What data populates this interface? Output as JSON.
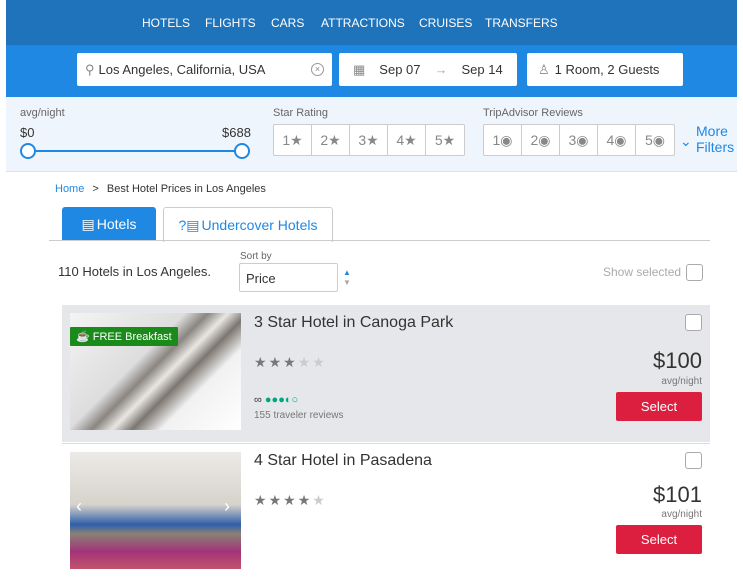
{
  "nav": [
    "HOTELS",
    "FLIGHTS",
    "CARS",
    "ATTRACTIONS",
    "CRUISES",
    "TRANSFERS"
  ],
  "search": {
    "location": "Los Angeles, California, USA",
    "checkin": "Sep 07",
    "checkout": "Sep 14",
    "guests": "1 Room, 2 Guests"
  },
  "filters": {
    "price_label": "avg/night",
    "min": "$0",
    "max": "$688",
    "star_label": "Star Rating",
    "stars": [
      "1",
      "2",
      "3",
      "4",
      "5"
    ],
    "ta_label": "TripAdvisor Reviews",
    "ta": [
      "1",
      "2",
      "3",
      "4",
      "5"
    ],
    "more": "More",
    "more2": "Filters"
  },
  "breadcrumb": {
    "home": "Home",
    "sep": ">",
    "current": "Best Hotel Prices in Los Angeles"
  },
  "tabs": {
    "hotels": "Hotels",
    "undercover": "Undercover Hotels"
  },
  "results": {
    "count": "110 Hotels in Los Angeles.",
    "sort_label": "Sort by",
    "sort_value": "Price",
    "show_selected": "Show selected"
  },
  "hotels": [
    {
      "name": "3 Star Hotel in Canoga Park",
      "stars": 3,
      "badge": "FREE Breakfast",
      "ta_rating": 3.5,
      "reviews": "155 traveler reviews",
      "price": "$100",
      "per": "avg/night",
      "select": "Select"
    },
    {
      "name": "4 Star Hotel in Pasadena",
      "stars": 4,
      "price": "$101",
      "per": "avg/night",
      "select": "Select"
    }
  ],
  "colors": {
    "nav": "#1f73ba",
    "search": "#1f88e3",
    "select": "#dc1e3f",
    "badge": "#1a8a1a",
    "ta": "#00a680"
  }
}
